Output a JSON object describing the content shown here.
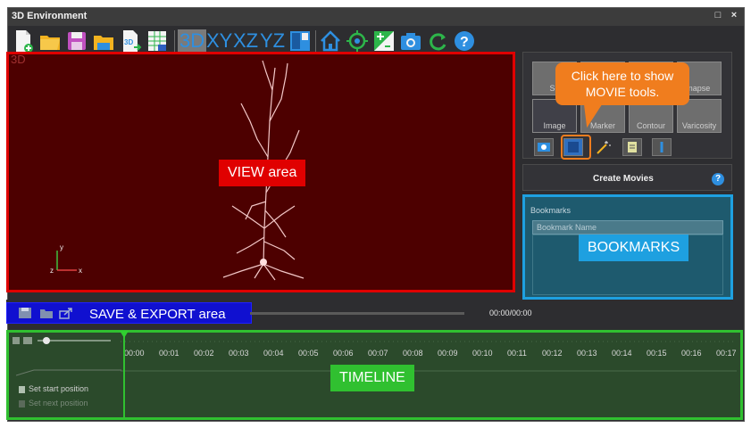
{
  "window": {
    "title": "3D Environment",
    "restore_glyph": "□",
    "close_glyph": "×"
  },
  "toolbar": {
    "view_buttons": [
      "3D",
      "XY",
      "XZ",
      "YZ"
    ],
    "icons": [
      "new-file-icon",
      "open-folder-icon",
      "save-icon",
      "open-folder-alt-icon",
      "export-3d-icon",
      "spreadsheet-icon",
      "panel-layout-icon",
      "home-icon",
      "target-icon",
      "color-scale-icon",
      "camera-icon",
      "refresh-icon",
      "help-icon"
    ]
  },
  "view": {
    "corner_label": "3D",
    "area_label": "VIEW area",
    "axis_x": "x",
    "axis_y": "y",
    "axis_z": "z"
  },
  "tools": {
    "tiles": [
      {
        "label": "So"
      },
      {
        "label": ""
      },
      {
        "label": ""
      },
      {
        "label": "napse"
      },
      {
        "label": "Image"
      },
      {
        "label": "Marker"
      },
      {
        "label": "Contour"
      },
      {
        "label": "Varicosity"
      }
    ]
  },
  "callout": {
    "line1": "Click here to show",
    "line2": "MOVIE tools."
  },
  "movies": {
    "title": "Create Movies",
    "help": "?"
  },
  "bookmarks": {
    "title": "Bookmarks",
    "column": "Bookmark Name",
    "area_label": "BOOKMARKS"
  },
  "playback": {
    "area_label": "SAVE & EXPORT area",
    "timecode": "00:00/00:00"
  },
  "timeline": {
    "area_label": "TIMELINE",
    "ticks": [
      "00:00",
      "00:01",
      "00:02",
      "00:03",
      "00:04",
      "00:05",
      "00:06",
      "00:07",
      "00:08",
      "00:09",
      "00:10",
      "00:11",
      "00:12",
      "00:13",
      "00:14",
      "00:15",
      "00:16",
      "00:17"
    ],
    "set_start": "Set start position",
    "set_next": "Set next position"
  },
  "colors": {
    "view_border": "#e00000",
    "bookmarks_border": "#1ea0e0",
    "timeline_border": "#30c030",
    "save_area": "#1010d0",
    "callout": "#f07d1e"
  }
}
